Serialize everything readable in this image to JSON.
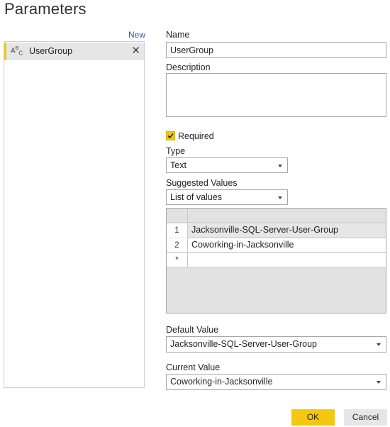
{
  "dialog": {
    "title": "Parameters"
  },
  "sidebar": {
    "new_label": "New",
    "items": [
      {
        "label": "UserGroup",
        "type_icon": "text-type-icon",
        "selected": true
      }
    ]
  },
  "form": {
    "name_label": "Name",
    "name_value": "UserGroup",
    "description_label": "Description",
    "description_value": "",
    "required_label": "Required",
    "required_checked": true,
    "type_label": "Type",
    "type_value": "Text",
    "suggested_label": "Suggested Values",
    "suggested_value": "List of values",
    "values_table": {
      "rows": [
        {
          "num": "",
          "value": ""
        },
        {
          "num": "1",
          "value": "Jacksonville-SQL-Server-User-Group"
        },
        {
          "num": "2",
          "value": "Coworking-in-Jacksonville"
        },
        {
          "num": "*",
          "value": ""
        }
      ]
    },
    "default_label": "Default Value",
    "default_value": "Jacksonville-SQL-Server-User-Group",
    "current_label": "Current Value",
    "current_value": "Coworking-in-Jacksonville"
  },
  "buttons": {
    "ok": "OK",
    "cancel": "Cancel"
  },
  "colors": {
    "accent": "#f2c811",
    "link": "#1f5fab",
    "selected_bg": "#e6e6e6"
  }
}
